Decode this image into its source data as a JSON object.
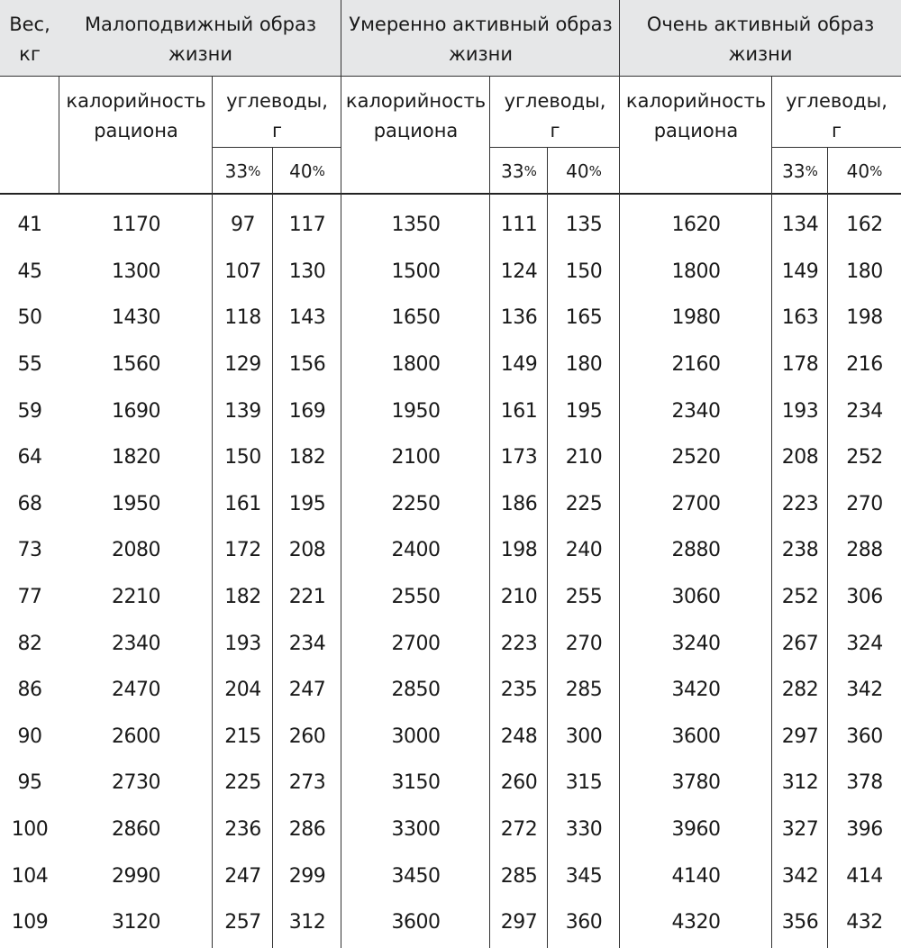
{
  "table": {
    "header": {
      "weight": "Вес,\nкг",
      "groups": [
        "Малоподвижный образ\nжизни",
        "Умеренно активный образ\nжизни",
        "Очень активный образ\nжизни"
      ],
      "calories": "калорийность\nрациона",
      "carbs": "углеводы,\nг",
      "pct33": "33",
      "pct40": "40",
      "pct_sign": "%"
    },
    "rows": [
      [
        "41",
        "1170",
        "97",
        "117",
        "1350",
        "111",
        "135",
        "1620",
        "134",
        "162"
      ],
      [
        "45",
        "1300",
        "107",
        "130",
        "1500",
        "124",
        "150",
        "1800",
        "149",
        "180"
      ],
      [
        "50",
        "1430",
        "118",
        "143",
        "1650",
        "136",
        "165",
        "1980",
        "163",
        "198"
      ],
      [
        "55",
        "1560",
        "129",
        "156",
        "1800",
        "149",
        "180",
        "2160",
        "178",
        "216"
      ],
      [
        "59",
        "1690",
        "139",
        "169",
        "1950",
        "161",
        "195",
        "2340",
        "193",
        "234"
      ],
      [
        "64",
        "1820",
        "150",
        "182",
        "2100",
        "173",
        "210",
        "2520",
        "208",
        "252"
      ],
      [
        "68",
        "1950",
        "161",
        "195",
        "2250",
        "186",
        "225",
        "2700",
        "223",
        "270"
      ],
      [
        "73",
        "2080",
        "172",
        "208",
        "2400",
        "198",
        "240",
        "2880",
        "238",
        "288"
      ],
      [
        "77",
        "2210",
        "182",
        "221",
        "2550",
        "210",
        "255",
        "3060",
        "252",
        "306"
      ],
      [
        "82",
        "2340",
        "193",
        "234",
        "2700",
        "223",
        "270",
        "3240",
        "267",
        "324"
      ],
      [
        "86",
        "2470",
        "204",
        "247",
        "2850",
        "235",
        "285",
        "3420",
        "282",
        "342"
      ],
      [
        "90",
        "2600",
        "215",
        "260",
        "3000",
        "248",
        "300",
        "3600",
        "297",
        "360"
      ],
      [
        "95",
        "2730",
        "225",
        "273",
        "3150",
        "260",
        "315",
        "3780",
        "312",
        "378"
      ],
      [
        "100",
        "2860",
        "236",
        "286",
        "3300",
        "272",
        "330",
        "3960",
        "327",
        "396"
      ],
      [
        "104",
        "2990",
        "247",
        "299",
        "3450",
        "285",
        "345",
        "4140",
        "342",
        "414"
      ],
      [
        "109",
        "3120",
        "257",
        "312",
        "3600",
        "297",
        "360",
        "4320",
        "356",
        "432"
      ]
    ]
  }
}
